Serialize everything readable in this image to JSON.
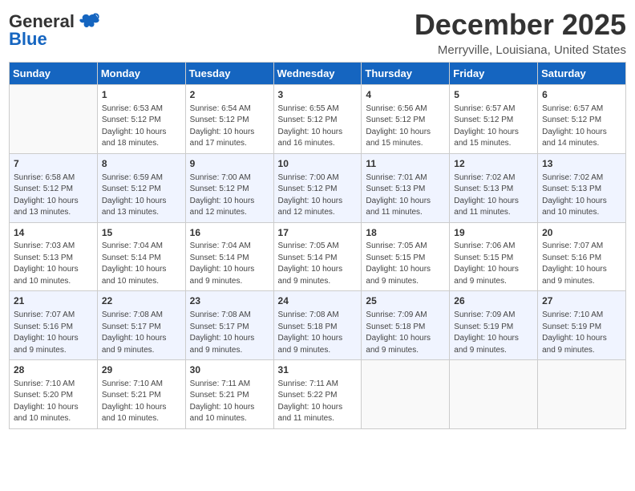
{
  "header": {
    "logo_general": "General",
    "logo_blue": "Blue",
    "month_title": "December 2025",
    "location": "Merryville, Louisiana, United States"
  },
  "calendar": {
    "days_of_week": [
      "Sunday",
      "Monday",
      "Tuesday",
      "Wednesday",
      "Thursday",
      "Friday",
      "Saturday"
    ],
    "weeks": [
      [
        {
          "day": "",
          "info": ""
        },
        {
          "day": "1",
          "info": "Sunrise: 6:53 AM\nSunset: 5:12 PM\nDaylight: 10 hours\nand 18 minutes."
        },
        {
          "day": "2",
          "info": "Sunrise: 6:54 AM\nSunset: 5:12 PM\nDaylight: 10 hours\nand 17 minutes."
        },
        {
          "day": "3",
          "info": "Sunrise: 6:55 AM\nSunset: 5:12 PM\nDaylight: 10 hours\nand 16 minutes."
        },
        {
          "day": "4",
          "info": "Sunrise: 6:56 AM\nSunset: 5:12 PM\nDaylight: 10 hours\nand 15 minutes."
        },
        {
          "day": "5",
          "info": "Sunrise: 6:57 AM\nSunset: 5:12 PM\nDaylight: 10 hours\nand 15 minutes."
        },
        {
          "day": "6",
          "info": "Sunrise: 6:57 AM\nSunset: 5:12 PM\nDaylight: 10 hours\nand 14 minutes."
        }
      ],
      [
        {
          "day": "7",
          "info": "Sunrise: 6:58 AM\nSunset: 5:12 PM\nDaylight: 10 hours\nand 13 minutes."
        },
        {
          "day": "8",
          "info": "Sunrise: 6:59 AM\nSunset: 5:12 PM\nDaylight: 10 hours\nand 13 minutes."
        },
        {
          "day": "9",
          "info": "Sunrise: 7:00 AM\nSunset: 5:12 PM\nDaylight: 10 hours\nand 12 minutes."
        },
        {
          "day": "10",
          "info": "Sunrise: 7:00 AM\nSunset: 5:12 PM\nDaylight: 10 hours\nand 12 minutes."
        },
        {
          "day": "11",
          "info": "Sunrise: 7:01 AM\nSunset: 5:13 PM\nDaylight: 10 hours\nand 11 minutes."
        },
        {
          "day": "12",
          "info": "Sunrise: 7:02 AM\nSunset: 5:13 PM\nDaylight: 10 hours\nand 11 minutes."
        },
        {
          "day": "13",
          "info": "Sunrise: 7:02 AM\nSunset: 5:13 PM\nDaylight: 10 hours\nand 10 minutes."
        }
      ],
      [
        {
          "day": "14",
          "info": "Sunrise: 7:03 AM\nSunset: 5:13 PM\nDaylight: 10 hours\nand 10 minutes."
        },
        {
          "day": "15",
          "info": "Sunrise: 7:04 AM\nSunset: 5:14 PM\nDaylight: 10 hours\nand 10 minutes."
        },
        {
          "day": "16",
          "info": "Sunrise: 7:04 AM\nSunset: 5:14 PM\nDaylight: 10 hours\nand 9 minutes."
        },
        {
          "day": "17",
          "info": "Sunrise: 7:05 AM\nSunset: 5:14 PM\nDaylight: 10 hours\nand 9 minutes."
        },
        {
          "day": "18",
          "info": "Sunrise: 7:05 AM\nSunset: 5:15 PM\nDaylight: 10 hours\nand 9 minutes."
        },
        {
          "day": "19",
          "info": "Sunrise: 7:06 AM\nSunset: 5:15 PM\nDaylight: 10 hours\nand 9 minutes."
        },
        {
          "day": "20",
          "info": "Sunrise: 7:07 AM\nSunset: 5:16 PM\nDaylight: 10 hours\nand 9 minutes."
        }
      ],
      [
        {
          "day": "21",
          "info": "Sunrise: 7:07 AM\nSunset: 5:16 PM\nDaylight: 10 hours\nand 9 minutes."
        },
        {
          "day": "22",
          "info": "Sunrise: 7:08 AM\nSunset: 5:17 PM\nDaylight: 10 hours\nand 9 minutes."
        },
        {
          "day": "23",
          "info": "Sunrise: 7:08 AM\nSunset: 5:17 PM\nDaylight: 10 hours\nand 9 minutes."
        },
        {
          "day": "24",
          "info": "Sunrise: 7:08 AM\nSunset: 5:18 PM\nDaylight: 10 hours\nand 9 minutes."
        },
        {
          "day": "25",
          "info": "Sunrise: 7:09 AM\nSunset: 5:18 PM\nDaylight: 10 hours\nand 9 minutes."
        },
        {
          "day": "26",
          "info": "Sunrise: 7:09 AM\nSunset: 5:19 PM\nDaylight: 10 hours\nand 9 minutes."
        },
        {
          "day": "27",
          "info": "Sunrise: 7:10 AM\nSunset: 5:19 PM\nDaylight: 10 hours\nand 9 minutes."
        }
      ],
      [
        {
          "day": "28",
          "info": "Sunrise: 7:10 AM\nSunset: 5:20 PM\nDaylight: 10 hours\nand 10 minutes."
        },
        {
          "day": "29",
          "info": "Sunrise: 7:10 AM\nSunset: 5:21 PM\nDaylight: 10 hours\nand 10 minutes."
        },
        {
          "day": "30",
          "info": "Sunrise: 7:11 AM\nSunset: 5:21 PM\nDaylight: 10 hours\nand 10 minutes."
        },
        {
          "day": "31",
          "info": "Sunrise: 7:11 AM\nSunset: 5:22 PM\nDaylight: 10 hours\nand 11 minutes."
        },
        {
          "day": "",
          "info": ""
        },
        {
          "day": "",
          "info": ""
        },
        {
          "day": "",
          "info": ""
        }
      ]
    ]
  }
}
